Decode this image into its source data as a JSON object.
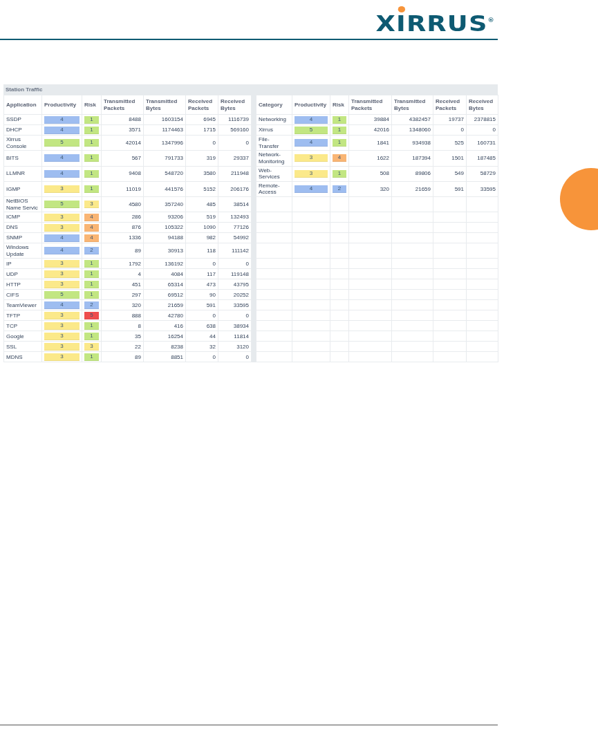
{
  "logo": {
    "text": "XIRRUS",
    "mark": "®"
  },
  "panel": {
    "title": "Station Traffic"
  },
  "applications": {
    "columns": [
      "Application",
      "Productivity",
      "Risk",
      "Transmitted Packets",
      "Transmitted Bytes",
      "Received Packets",
      "Received Bytes"
    ],
    "rows": [
      {
        "name": "SSDP",
        "productivity": {
          "value": "4",
          "color": "#9ebdf0"
        },
        "risk": {
          "value": "1",
          "color": "#c2e682"
        },
        "tx_packets": "8488",
        "tx_bytes": "1603154",
        "rx_packets": "6945",
        "rx_bytes": "1116739"
      },
      {
        "name": "DHCP",
        "productivity": {
          "value": "4",
          "color": "#9ebdf0"
        },
        "risk": {
          "value": "1",
          "color": "#c2e682"
        },
        "tx_packets": "3571",
        "tx_bytes": "1174463",
        "rx_packets": "1715",
        "rx_bytes": "569160"
      },
      {
        "name": "Xirrus Console",
        "productivity": {
          "value": "5",
          "color": "#c2e682"
        },
        "risk": {
          "value": "1",
          "color": "#c2e682"
        },
        "tx_packets": "42014",
        "tx_bytes": "1347996",
        "rx_packets": "0",
        "rx_bytes": "0"
      },
      {
        "name": "BITS",
        "productivity": {
          "value": "4",
          "color": "#9ebdf0"
        },
        "risk": {
          "value": "1",
          "color": "#c2e682"
        },
        "tx_packets": "567",
        "tx_bytes": "791733",
        "rx_packets": "319",
        "rx_bytes": "29337"
      },
      {
        "name": "LLMNR",
        "productivity": {
          "value": "4",
          "color": "#9ebdf0"
        },
        "risk": {
          "value": "1",
          "color": "#c2e682"
        },
        "tx_packets": "9408",
        "tx_bytes": "548720",
        "rx_packets": "3580",
        "rx_bytes": "211948"
      },
      {
        "name": "IGMP",
        "productivity": {
          "value": "3",
          "color": "#fbe98a"
        },
        "risk": {
          "value": "1",
          "color": "#c2e682"
        },
        "tx_packets": "11019",
        "tx_bytes": "441576",
        "rx_packets": "5152",
        "rx_bytes": "206176"
      },
      {
        "name": "NetBIOS Name Servic",
        "productivity": {
          "value": "5",
          "color": "#c2e682"
        },
        "risk": {
          "value": "3",
          "color": "#fbe98a"
        },
        "tx_packets": "4580",
        "tx_bytes": "357240",
        "rx_packets": "485",
        "rx_bytes": "38514"
      },
      {
        "name": "ICMP",
        "productivity": {
          "value": "3",
          "color": "#fbe98a"
        },
        "risk": {
          "value": "4",
          "color": "#f9b574"
        },
        "tx_packets": "286",
        "tx_bytes": "93206",
        "rx_packets": "519",
        "rx_bytes": "132493"
      },
      {
        "name": "DNS",
        "productivity": {
          "value": "3",
          "color": "#fbe98a"
        },
        "risk": {
          "value": "4",
          "color": "#f9b574"
        },
        "tx_packets": "876",
        "tx_bytes": "105322",
        "rx_packets": "1090",
        "rx_bytes": "77126"
      },
      {
        "name": "SNMP",
        "productivity": {
          "value": "4",
          "color": "#9ebdf0"
        },
        "risk": {
          "value": "4",
          "color": "#f9b574"
        },
        "tx_packets": "1336",
        "tx_bytes": "94188",
        "rx_packets": "982",
        "rx_bytes": "54992"
      },
      {
        "name": "Windows Update",
        "productivity": {
          "value": "4",
          "color": "#9ebdf0"
        },
        "risk": {
          "value": "2",
          "color": "#9ebdf0"
        },
        "tx_packets": "89",
        "tx_bytes": "30913",
        "rx_packets": "118",
        "rx_bytes": "111142"
      },
      {
        "name": "IP",
        "productivity": {
          "value": "3",
          "color": "#fbe98a"
        },
        "risk": {
          "value": "1",
          "color": "#c2e682"
        },
        "tx_packets": "1792",
        "tx_bytes": "136192",
        "rx_packets": "0",
        "rx_bytes": "0"
      },
      {
        "name": "UDP",
        "productivity": {
          "value": "3",
          "color": "#fbe98a"
        },
        "risk": {
          "value": "1",
          "color": "#c2e682"
        },
        "tx_packets": "4",
        "tx_bytes": "4084",
        "rx_packets": "117",
        "rx_bytes": "119148"
      },
      {
        "name": "HTTP",
        "productivity": {
          "value": "3",
          "color": "#fbe98a"
        },
        "risk": {
          "value": "1",
          "color": "#c2e682"
        },
        "tx_packets": "451",
        "tx_bytes": "65314",
        "rx_packets": "473",
        "rx_bytes": "43795"
      },
      {
        "name": "CIFS",
        "productivity": {
          "value": "5",
          "color": "#c2e682"
        },
        "risk": {
          "value": "1",
          "color": "#c2e682"
        },
        "tx_packets": "297",
        "tx_bytes": "69512",
        "rx_packets": "90",
        "rx_bytes": "20252"
      },
      {
        "name": "TeamViewer",
        "productivity": {
          "value": "4",
          "color": "#9ebdf0"
        },
        "risk": {
          "value": "2",
          "color": "#9ebdf0"
        },
        "tx_packets": "320",
        "tx_bytes": "21659",
        "rx_packets": "591",
        "rx_bytes": "33595"
      },
      {
        "name": "TFTP",
        "productivity": {
          "value": "3",
          "color": "#fbe98a"
        },
        "risk": {
          "value": "5",
          "color": "#ee4d4d"
        },
        "tx_packets": "888",
        "tx_bytes": "42780",
        "rx_packets": "0",
        "rx_bytes": "0"
      },
      {
        "name": "TCP",
        "productivity": {
          "value": "3",
          "color": "#fbe98a"
        },
        "risk": {
          "value": "1",
          "color": "#c2e682"
        },
        "tx_packets": "8",
        "tx_bytes": "416",
        "rx_packets": "638",
        "rx_bytes": "38934"
      },
      {
        "name": "Google",
        "productivity": {
          "value": "3",
          "color": "#fbe98a"
        },
        "risk": {
          "value": "1",
          "color": "#c2e682"
        },
        "tx_packets": "35",
        "tx_bytes": "16254",
        "rx_packets": "44",
        "rx_bytes": "11814"
      },
      {
        "name": "SSL",
        "productivity": {
          "value": "3",
          "color": "#fbe98a"
        },
        "risk": {
          "value": "3",
          "color": "#fbe98a"
        },
        "tx_packets": "22",
        "tx_bytes": "8238",
        "rx_packets": "32",
        "rx_bytes": "3120"
      },
      {
        "name": "MDNS",
        "productivity": {
          "value": "3",
          "color": "#fbe98a"
        },
        "risk": {
          "value": "1",
          "color": "#c2e682"
        },
        "tx_packets": "89",
        "tx_bytes": "8851",
        "rx_packets": "0",
        "rx_bytes": "0"
      }
    ]
  },
  "categories": {
    "columns": [
      "Category",
      "Productivity",
      "Risk",
      "Transmitted Packets",
      "Transmitted Bytes",
      "Received Packets",
      "Received Bytes"
    ],
    "rows": [
      {
        "name": "Networking",
        "productivity": {
          "value": "4",
          "color": "#9ebdf0"
        },
        "risk": {
          "value": "1",
          "color": "#c2e682"
        },
        "tx_packets": "39884",
        "tx_bytes": "4382457",
        "rx_packets": "19737",
        "rx_bytes": "2378815"
      },
      {
        "name": "Xirrus",
        "productivity": {
          "value": "5",
          "color": "#c2e682"
        },
        "risk": {
          "value": "1",
          "color": "#c2e682"
        },
        "tx_packets": "42016",
        "tx_bytes": "1348060",
        "rx_packets": "0",
        "rx_bytes": "0"
      },
      {
        "name": "File-Transfer",
        "productivity": {
          "value": "4",
          "color": "#9ebdf0"
        },
        "risk": {
          "value": "1",
          "color": "#c2e682"
        },
        "tx_packets": "1841",
        "tx_bytes": "934938",
        "rx_packets": "525",
        "rx_bytes": "160731"
      },
      {
        "name": "Network-Monitoring",
        "productivity": {
          "value": "3",
          "color": "#fbe98a"
        },
        "risk": {
          "value": "4",
          "color": "#f9b574"
        },
        "tx_packets": "1622",
        "tx_bytes": "187394",
        "rx_packets": "1501",
        "rx_bytes": "187485"
      },
      {
        "name": "Web-Services",
        "productivity": {
          "value": "3",
          "color": "#fbe98a"
        },
        "risk": {
          "value": "1",
          "color": "#c2e682"
        },
        "tx_packets": "508",
        "tx_bytes": "89806",
        "rx_packets": "549",
        "rx_bytes": "58729"
      },
      {
        "name": "Remote-Access",
        "productivity": {
          "value": "4",
          "color": "#9ebdf0"
        },
        "risk": {
          "value": "2",
          "color": "#9ebdf0"
        },
        "tx_packets": "320",
        "tx_bytes": "21659",
        "rx_packets": "591",
        "rx_bytes": "33595"
      }
    ]
  }
}
